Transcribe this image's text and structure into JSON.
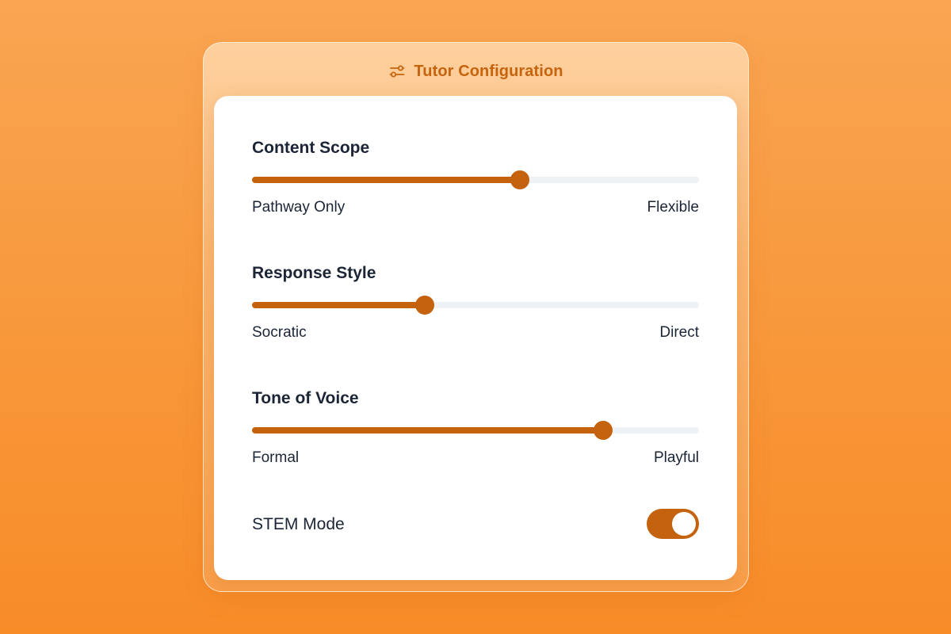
{
  "header": {
    "title": "Tutor Configuration",
    "icon": "sliders-icon"
  },
  "settings": [
    {
      "title": "Content Scope",
      "min_label": "Pathway Only",
      "max_label": "Flexible",
      "value": 0.6
    },
    {
      "title": "Response Style",
      "min_label": "Socratic",
      "max_label": "Direct",
      "value": 0.387
    },
    {
      "title": "Tone of Voice",
      "min_label": "Formal",
      "max_label": "Playful",
      "value": 0.785
    }
  ],
  "stem_mode": {
    "label": "STEM Mode",
    "enabled": true
  },
  "colors": {
    "accent": "#c4620d",
    "track": "#eef2f6",
    "text": "#1b2536",
    "header_text": "#c6640e"
  }
}
